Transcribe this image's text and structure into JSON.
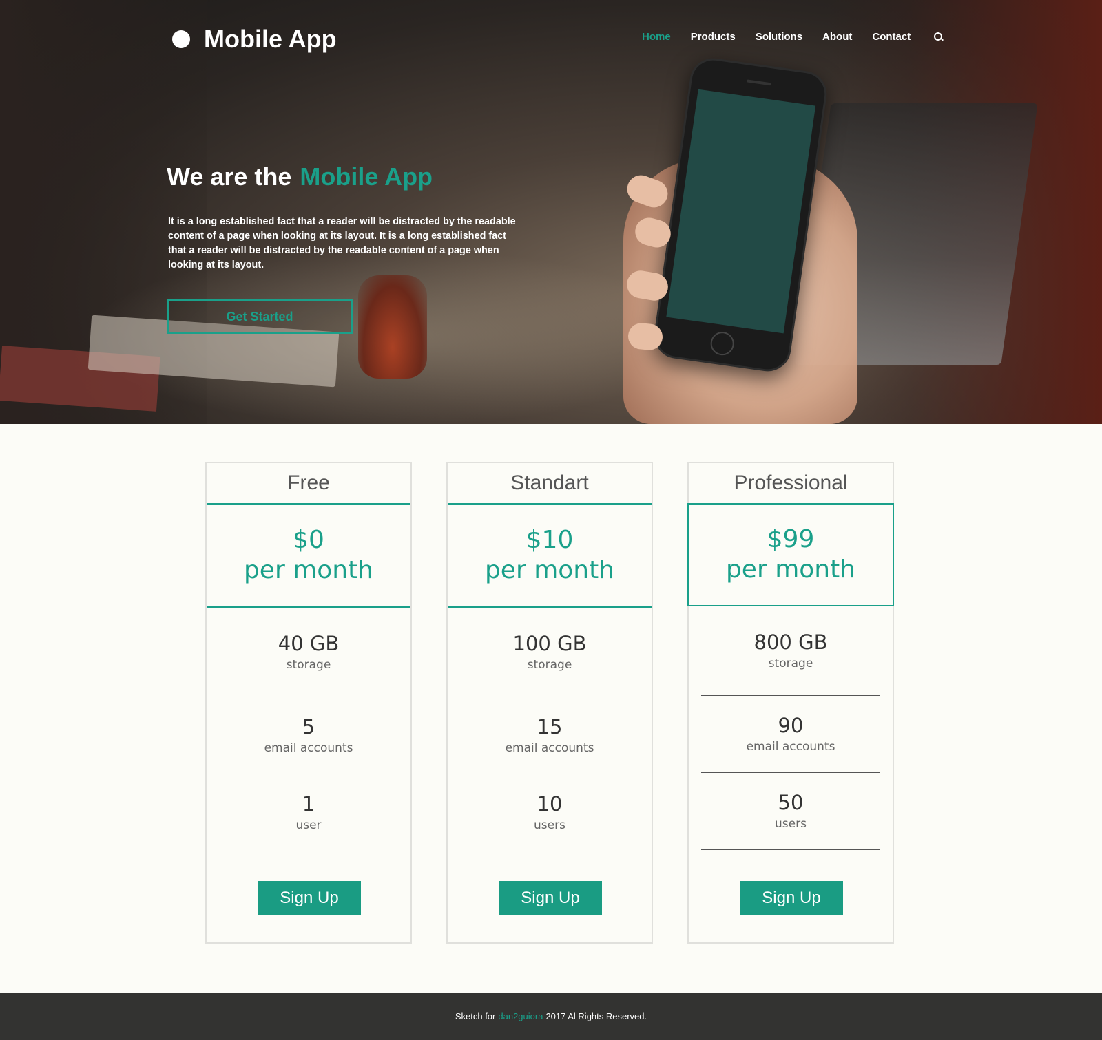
{
  "header": {
    "logo_text": "Mobile App",
    "nav": [
      {
        "label": "Home",
        "active": true
      },
      {
        "label": "Products",
        "active": false
      },
      {
        "label": "Solutions",
        "active": false
      },
      {
        "label": "About",
        "active": false
      },
      {
        "label": "Contact",
        "active": false
      }
    ],
    "search_icon": "search-icon"
  },
  "hero": {
    "title_prefix": "We are the",
    "title_accent": "Mobile App",
    "text": "It is a long established fact that a reader will be distracted by the readable content of a page when looking at its layout. It is a long established fact that a reader will be distracted by the readable content of a page when looking at its layout.",
    "cta_label": "Get Started"
  },
  "plans": [
    {
      "name": "Free",
      "price": "$0",
      "period": "per month",
      "highlight": false,
      "features": [
        {
          "value": "40 GB",
          "label": "storage"
        },
        {
          "value": "5",
          "label": "email accounts"
        },
        {
          "value": "1",
          "label": "user"
        }
      ],
      "button": "Sign Up"
    },
    {
      "name": "Standart",
      "price": "$10",
      "period": "per month",
      "highlight": false,
      "features": [
        {
          "value": "100 GB",
          "label": "storage"
        },
        {
          "value": "15",
          "label": "email accounts"
        },
        {
          "value": "10",
          "label": "users"
        }
      ],
      "button": "Sign Up"
    },
    {
      "name": "Professional",
      "price": "$99",
      "period": "per month",
      "highlight": true,
      "features": [
        {
          "value": "800 GB",
          "label": "storage"
        },
        {
          "value": "90",
          "label": "email accounts"
        },
        {
          "value": "50",
          "label": "users"
        }
      ],
      "button": "Sign Up"
    }
  ],
  "footer": {
    "prefix": "Sketch for",
    "link": "dan2guiora",
    "suffix": "2017 Al Rights Reserved."
  },
  "colors": {
    "accent": "#1aa08a",
    "footer_bg": "#333331",
    "page_bg": "#fcfcf7"
  }
}
